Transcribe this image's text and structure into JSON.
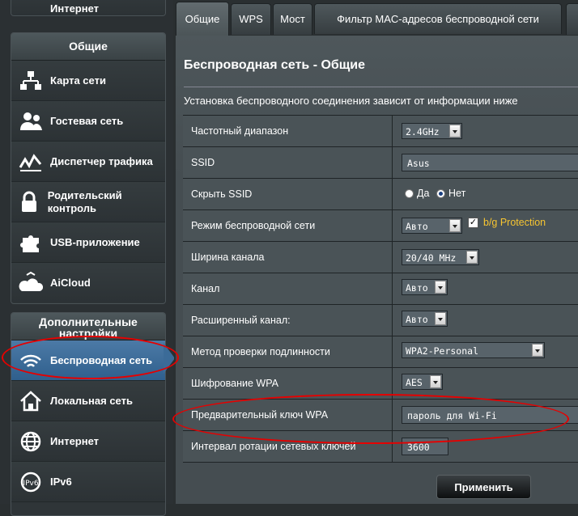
{
  "sidebar": {
    "top_item": "Интернет",
    "general_header": "Общие",
    "general_items": [
      {
        "label": "Карта сети",
        "icon": "network-map-icon"
      },
      {
        "label": "Гостевая сеть",
        "icon": "guest-network-icon"
      },
      {
        "label": "Диспетчер трафика",
        "icon": "traffic-manager-icon"
      },
      {
        "label": "Родительский контроль",
        "icon": "parental-control-icon"
      },
      {
        "label": "USB-приложение",
        "icon": "usb-app-icon"
      },
      {
        "label": "AiCloud",
        "icon": "aicloud-icon"
      }
    ],
    "advanced_header": "Дополнительные настройки",
    "advanced_items": [
      {
        "label": "Беспроводная сеть",
        "icon": "wireless-icon",
        "active": true
      },
      {
        "label": "Локальная сеть",
        "icon": "home-lan-icon"
      },
      {
        "label": "Интернет",
        "icon": "globe-icon"
      },
      {
        "label": "IPv6",
        "icon": "ipv6-icon"
      }
    ]
  },
  "tabs": [
    "Общие",
    "WPS",
    "Мост",
    "Фильтр MAC-адресов беспроводной сети"
  ],
  "panel": {
    "title": "Беспроводная сеть - Общие",
    "description": "Установка беспроводного соединения зависит от информации ниже",
    "rows": {
      "band": {
        "label": "Частотный диапазон",
        "value": "2.4GHz"
      },
      "ssid": {
        "label": "SSID",
        "value": "Asus"
      },
      "hide_ssid": {
        "label": "Скрыть SSID",
        "yes": "Да",
        "no": "Нет",
        "selected": "Нет"
      },
      "mode": {
        "label": "Режим беспроводной сети",
        "value": "Авто",
        "protection": "b/g Protection",
        "protection_checked": true
      },
      "width": {
        "label": "Ширина канала",
        "value": "20/40 MHz"
      },
      "channel": {
        "label": "Канал",
        "value": "Авто"
      },
      "ext_channel": {
        "label": "Расширенный канал:",
        "value": "Авто"
      },
      "auth": {
        "label": "Метод проверки подлинности",
        "value": "WPA2-Personal"
      },
      "encryption": {
        "label": "Шифрование WPA",
        "value": "AES"
      },
      "psk": {
        "label": "Предварительный ключ WPA",
        "value": "пароль для Wi-Fi"
      },
      "rotation": {
        "label": "Интервал ротации сетевых ключей",
        "value": "3600"
      }
    },
    "apply_label": "Применить"
  },
  "colors": {
    "highlight": "#e60000",
    "accent": "#f7c531",
    "active": "#3b6b98"
  }
}
